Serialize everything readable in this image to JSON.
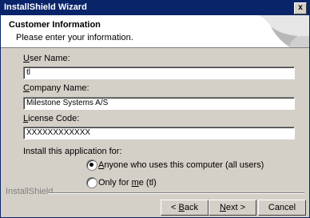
{
  "window": {
    "title": "InstallShield Wizard",
    "close_glyph": "x"
  },
  "header": {
    "title": "Customer Information",
    "subtitle": "Please enter your information."
  },
  "form": {
    "user_name": {
      "label_mnemonic": "U",
      "label_rest": "ser Name:",
      "value": "tl"
    },
    "company_name": {
      "label_mnemonic": "C",
      "label_rest": "ompany Name:",
      "value": "Milestone Systems A/S"
    },
    "license_code": {
      "label_mnemonic": "L",
      "label_rest": "icense Code:",
      "value": "XXXXXXXXXXXX"
    },
    "install_for_label": "Install this application for:",
    "options": [
      {
        "mnemonic": "A",
        "rest": "nyone who uses this computer (all users)",
        "selected": true
      },
      {
        "prefix": "Only for ",
        "mnemonic": "m",
        "rest": "e (tl)",
        "selected": false
      }
    ]
  },
  "footer": {
    "brand": "InstallShield",
    "back": {
      "mnemonic": "B",
      "rest": "ack",
      "prefix": "< "
    },
    "next": {
      "mnemonic": "N",
      "rest": "ext >"
    },
    "cancel": "Cancel"
  }
}
